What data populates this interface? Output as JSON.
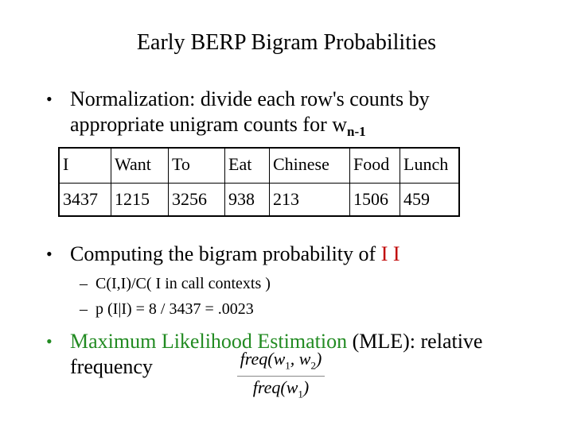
{
  "slide": {
    "title": "Early BERP Bigram Probabilities",
    "bullets": [
      {
        "text": "Normalization:  divide each row's counts by appropriate unigram counts for w",
        "subscript": "n-1"
      },
      {
        "text": "Computing the bigram probability of ",
        "highlight": "I I",
        "highlight_color": "#c00000",
        "subitems": [
          "C(I,I)/C( I in call contexts )",
          "p (I|I) = 8 / 3437 = .0023"
        ]
      },
      {
        "highlight": "Maximum Likelihood Estimation",
        "highlight_color": "#228b22",
        "text": " (MLE): relative frequency",
        "formula": {
          "numerator": "freq(w1, w2)",
          "denominator": "freq(w1)"
        }
      }
    ],
    "table": {
      "headers": [
        "I",
        "Want",
        "To",
        "Eat",
        "Chinese",
        "Food",
        "Lunch"
      ],
      "values": [
        "3437",
        "1215",
        "3256",
        "938",
        "213",
        "1506",
        "459"
      ]
    },
    "bullet_glyph": "•",
    "dash_glyph": "–"
  }
}
